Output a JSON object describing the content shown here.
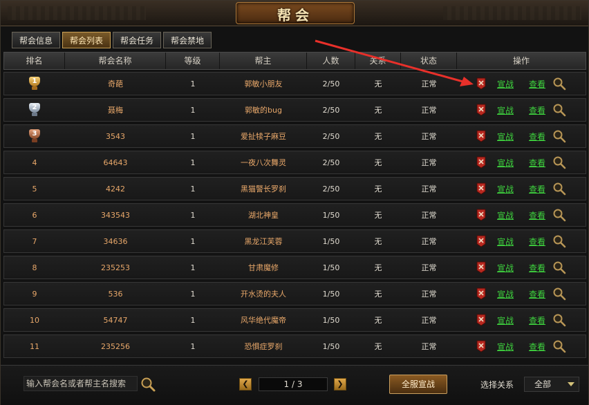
{
  "title": "帮会",
  "tabs": [
    {
      "label": "帮会信息",
      "active": false
    },
    {
      "label": "帮会列表",
      "active": true
    },
    {
      "label": "帮会任务",
      "active": false
    },
    {
      "label": "帮会禁地",
      "active": false
    }
  ],
  "columns": {
    "rank": "排名",
    "name": "帮会名称",
    "level": "等级",
    "leader": "帮主",
    "count": "人数",
    "relation": "关系",
    "status": "状态",
    "ops": "操作"
  },
  "rows": [
    {
      "rank": "1",
      "medal": "gold",
      "name": "奇葩",
      "level": "1",
      "leader": "郭敏小朋友",
      "count": "2/50",
      "relation": "无",
      "status": "正常"
    },
    {
      "rank": "2",
      "medal": "silver",
      "name": "聂梅",
      "level": "1",
      "leader": "郭敏的bug",
      "count": "2/50",
      "relation": "无",
      "status": "正常"
    },
    {
      "rank": "3",
      "medal": "bronze",
      "name": "3543",
      "level": "1",
      "leader": "爱扯犊子麻豆",
      "count": "2/50",
      "relation": "无",
      "status": "正常"
    },
    {
      "rank": "4",
      "medal": "",
      "name": "64643",
      "level": "1",
      "leader": "一夜八次舞灵",
      "count": "2/50",
      "relation": "无",
      "status": "正常"
    },
    {
      "rank": "5",
      "medal": "",
      "name": "4242",
      "level": "1",
      "leader": "黑猫警长罗刹",
      "count": "2/50",
      "relation": "无",
      "status": "正常"
    },
    {
      "rank": "6",
      "medal": "",
      "name": "343543",
      "level": "1",
      "leader": "湖北神皇",
      "count": "1/50",
      "relation": "无",
      "status": "正常"
    },
    {
      "rank": "7",
      "medal": "",
      "name": "34636",
      "level": "1",
      "leader": "黑龙江芙蓉",
      "count": "1/50",
      "relation": "无",
      "status": "正常"
    },
    {
      "rank": "8",
      "medal": "",
      "name": "235253",
      "level": "1",
      "leader": "甘肃魔修",
      "count": "1/50",
      "relation": "无",
      "status": "正常"
    },
    {
      "rank": "9",
      "medal": "",
      "name": "536",
      "level": "1",
      "leader": "开水烫的夫人",
      "count": "1/50",
      "relation": "无",
      "status": "正常"
    },
    {
      "rank": "10",
      "medal": "",
      "name": "54747",
      "level": "1",
      "leader": "风华绝代魔帝",
      "count": "1/50",
      "relation": "无",
      "status": "正常"
    },
    {
      "rank": "11",
      "medal": "",
      "name": "235256",
      "level": "1",
      "leader": "恐惧症罗刹",
      "count": "1/50",
      "relation": "无",
      "status": "正常"
    }
  ],
  "ops": {
    "declare_war": "宣战",
    "view": "查看"
  },
  "bottom": {
    "search_placeholder": "输入帮会名或者帮主名搜索",
    "page_display": "1 / 3",
    "prev": "❮",
    "next": "❯",
    "war_all": "全服宣战",
    "relation_label": "选择关系",
    "relation_value": "全部"
  },
  "colors": {
    "accent_gold": "#c9a055",
    "link_green": "#3ed33e",
    "text_orange": "#e9a86a",
    "arrow_red": "#e8302a"
  },
  "icons": {
    "flag": "red-banner-icon",
    "zoom": "magnifier-icon"
  }
}
